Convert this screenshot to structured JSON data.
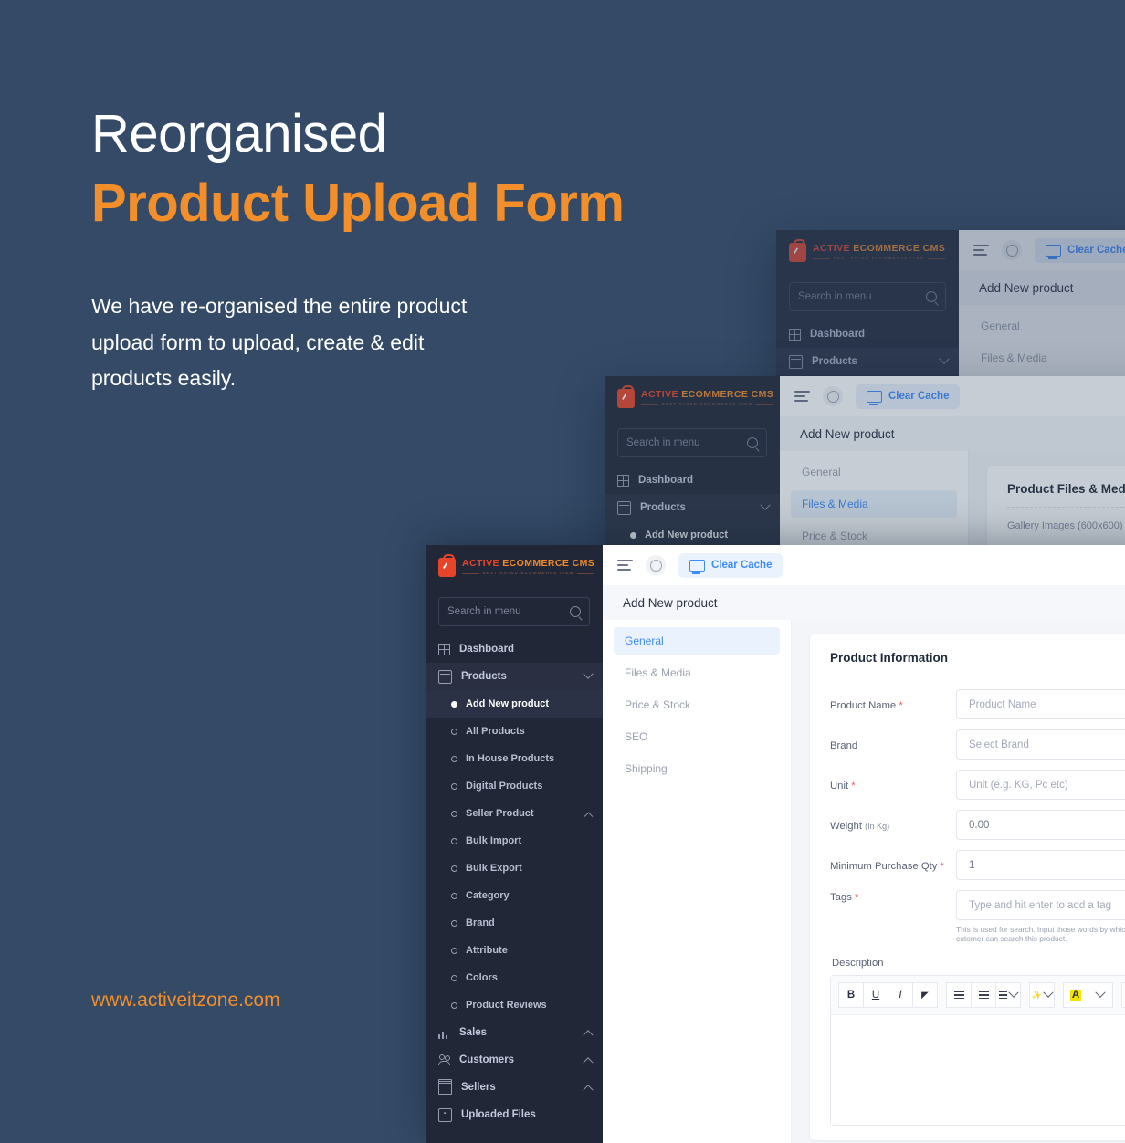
{
  "promo": {
    "title_line1": "Reorganised",
    "title_line2": "Product Upload Form",
    "description": "We have re-organised the entire product upload form to upload, create & edit products easily.",
    "url": "www.activeitzone.com",
    "accent_color": "#f28f2a",
    "background_color": "#344a66"
  },
  "brand": {
    "name_part1": "ACTIVE",
    "name_part2": "ECOMMERCE",
    "name_part3": "CMS",
    "tagline": "BEST RATED ECOMMERCE ITEM",
    "logo_icon": "shopping-bag-icon"
  },
  "sidebar": {
    "search_placeholder": "Search in menu",
    "search_icon": "search-icon",
    "items": [
      {
        "label": "Dashboard",
        "icon": "grid-icon",
        "chevron": ""
      },
      {
        "label": "Products",
        "icon": "box-icon",
        "chevron": "down"
      },
      {
        "label": "Sales",
        "icon": "chart-icon",
        "chevron": "up"
      },
      {
        "label": "Customers",
        "icon": "users-icon",
        "chevron": "up"
      },
      {
        "label": "Sellers",
        "icon": "shop-icon",
        "chevron": "up"
      },
      {
        "label": "Uploaded Files",
        "icon": "upload-icon",
        "chevron": ""
      }
    ],
    "product_submenu": [
      {
        "label": "Add New product",
        "current": true,
        "chevron": ""
      },
      {
        "label": "All Products",
        "current": false,
        "chevron": ""
      },
      {
        "label": "In House Products",
        "current": false,
        "chevron": ""
      },
      {
        "label": "Digital Products",
        "current": false,
        "chevron": ""
      },
      {
        "label": "Seller Product",
        "current": false,
        "chevron": "up"
      },
      {
        "label": "Bulk Import",
        "current": false,
        "chevron": ""
      },
      {
        "label": "Bulk Export",
        "current": false,
        "chevron": ""
      },
      {
        "label": "Category",
        "current": false,
        "chevron": ""
      },
      {
        "label": "Brand",
        "current": false,
        "chevron": ""
      },
      {
        "label": "Attribute",
        "current": false,
        "chevron": ""
      },
      {
        "label": "Colors",
        "current": false,
        "chevron": ""
      },
      {
        "label": "Product Reviews",
        "current": false,
        "chevron": ""
      }
    ]
  },
  "topbar": {
    "menu_icon": "hamburger-icon",
    "language_icon": "globe-icon",
    "clear_cache_label": "Clear Cache",
    "clear_cache_icon": "monitor-icon",
    "accent_color": "#3d8bfd"
  },
  "page": {
    "heading": "Add New product"
  },
  "tabs": [
    {
      "label": "General",
      "active": true
    },
    {
      "label": "Files & Media",
      "active": false
    },
    {
      "label": "Price & Stock",
      "active": false
    },
    {
      "label": "SEO",
      "active": false
    },
    {
      "label": "Shipping",
      "active": false
    }
  ],
  "tabs_card2": [
    {
      "label": "General",
      "active": false
    },
    {
      "label": "Files & Media",
      "active": true
    },
    {
      "label": "Price & Stock",
      "active": false
    }
  ],
  "tabs_card3": [
    {
      "label": "General",
      "active": false
    },
    {
      "label": "Files & Media",
      "active": false
    }
  ],
  "panel": {
    "title": "Product Information",
    "fields": [
      {
        "label": "Product Name",
        "required": true,
        "note": "",
        "value": "Product Name",
        "filled": false
      },
      {
        "label": "Brand",
        "required": false,
        "note": "",
        "value": "Select Brand",
        "filled": false
      },
      {
        "label": "Unit",
        "required": true,
        "note": "",
        "value": "Unit (e.g. KG, Pc etc)",
        "filled": false
      },
      {
        "label": "Weight",
        "required": false,
        "note": "(In Kg)",
        "value": "0.00",
        "filled": true
      },
      {
        "label": "Minimum Purchase Qty",
        "required": true,
        "note": "",
        "value": "1",
        "filled": true
      },
      {
        "label": "Tags",
        "required": true,
        "note": "",
        "value": "Type and hit enter to add a tag",
        "filled": false
      }
    ],
    "tags_hint": "This is used for search. Input those words by which cutomer can search this product."
  },
  "panel_card2": {
    "title": "Product Files & Media",
    "subtitle": "Gallery Images (600x600)"
  },
  "description": {
    "label": "Description",
    "toolbar": [
      {
        "name": "bold-button",
        "glyph": "B",
        "style": "bold"
      },
      {
        "name": "underline-button",
        "glyph": "U",
        "style": "under"
      },
      {
        "name": "italic-button",
        "glyph": "I",
        "style": "italic"
      },
      {
        "name": "eraser-button",
        "glyph": "◤",
        "style": "plain"
      },
      {
        "name": "unordered-list-button",
        "glyph": "☰",
        "style": "bars"
      },
      {
        "name": "ordered-list-button",
        "glyph": "☰",
        "style": "bars"
      },
      {
        "name": "align-button",
        "glyph": "☰",
        "style": "caret"
      },
      {
        "name": "magic-button",
        "glyph": "✨",
        "style": "caret"
      },
      {
        "name": "text-color-button",
        "glyph": "A",
        "style": "hl"
      },
      {
        "name": "table-button",
        "glyph": "▦",
        "style": "caret"
      }
    ]
  }
}
